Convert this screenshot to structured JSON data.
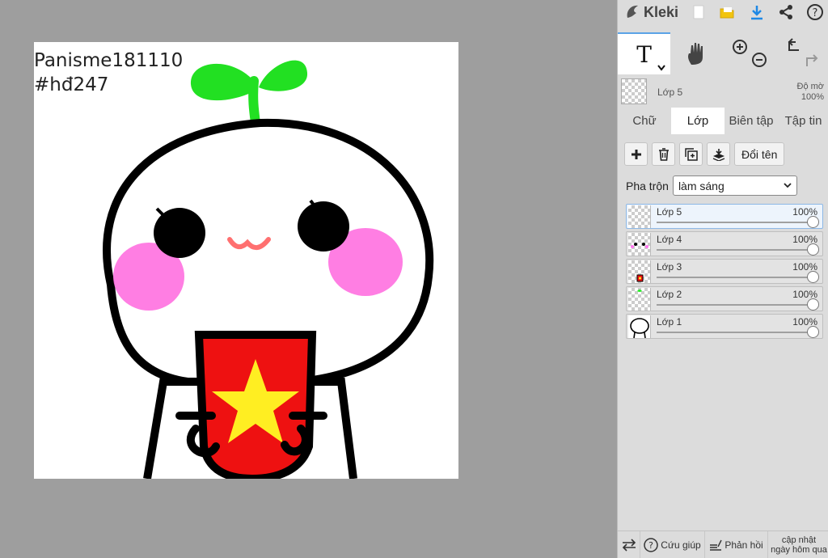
{
  "canvas": {
    "watermark_line1": "Panisme181110",
    "watermark_line2": "#hđ247"
  },
  "topbar": {
    "logo_label": "Kleki",
    "icons": [
      "new-file-icon",
      "open-folder-icon",
      "download-icon",
      "share-icon",
      "help-icon"
    ]
  },
  "tools": {
    "text_tool": "T",
    "icons": [
      "text-tool-icon",
      "hand-tool-icon",
      "zoom-in-icon",
      "zoom-out-icon",
      "undo-icon",
      "redo-icon"
    ]
  },
  "current_layer": {
    "name": "Lớp 5",
    "opacity_label": "Độ mờ",
    "opacity_value": "100%"
  },
  "tabs": [
    {
      "label": "Chữ"
    },
    {
      "label": "Lớp"
    },
    {
      "label": "Biên tập"
    },
    {
      "label": "Tập tin"
    }
  ],
  "layer_panel": {
    "rename_label": "Đổi tên",
    "blend_label": "Pha trộn",
    "blend_value": "làm sáng",
    "layers": [
      {
        "name": "Lớp 5",
        "opacity": "100%"
      },
      {
        "name": "Lớp 4",
        "opacity": "100%"
      },
      {
        "name": "Lớp 3",
        "opacity": "100%"
      },
      {
        "name": "Lớp 2",
        "opacity": "100%"
      },
      {
        "name": "Lớp 1",
        "opacity": "100%"
      }
    ]
  },
  "footer": {
    "help_label": "Cứu giúp",
    "feedback_label": "Phản hồi",
    "update_line1": "cập nhật",
    "update_line2": "ngày hôm qua"
  },
  "colors": {
    "accent": "#5ba3e6",
    "canvas_bg": "#9e9e9e",
    "panel_bg": "#dcdcdc"
  }
}
